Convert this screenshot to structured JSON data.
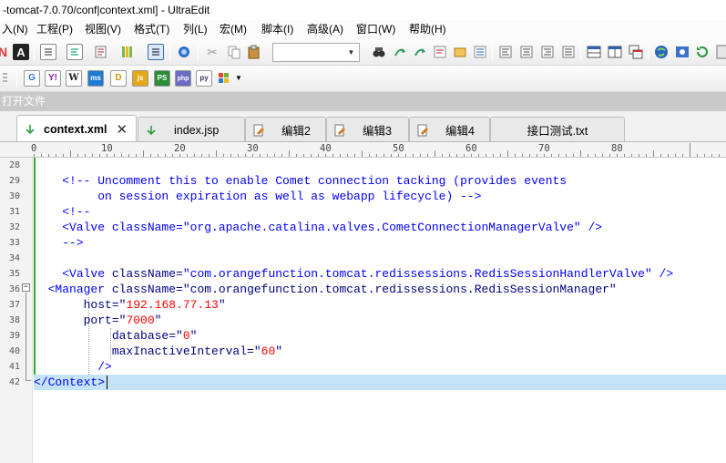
{
  "window": {
    "title": "-tomcat-7.0.70/conf|context.xml] - UltraEdit"
  },
  "menu": [
    {
      "label": "入(N)"
    },
    {
      "label": "工程(P)"
    },
    {
      "label": "视图(V)"
    },
    {
      "label": "格式(T)"
    },
    {
      "label": "列(L)"
    },
    {
      "label": "宏(M)"
    },
    {
      "label": "脚本(I)"
    },
    {
      "label": "高级(A)"
    },
    {
      "label": "窗口(W)"
    },
    {
      "label": "帮助(H)"
    }
  ],
  "toolbar": {
    "combo_value": ""
  },
  "openfile_label": "打开文件",
  "tabs": [
    {
      "label": "context.xml",
      "icon": "down-arrow-icon",
      "active": true
    },
    {
      "label": "index.jsp",
      "icon": "down-arrow-icon",
      "active": false
    },
    {
      "label": "编辑2",
      "icon": "edit-page-icon",
      "active": false
    },
    {
      "label": "编辑3",
      "icon": "edit-page-icon",
      "active": false
    },
    {
      "label": "编辑4",
      "icon": "edit-page-icon",
      "active": false
    },
    {
      "label": "接口测试.txt",
      "icon": "",
      "active": false
    }
  ],
  "ruler": {
    "labels": [
      "0",
      "10",
      "20",
      "30",
      "40",
      "50",
      "60",
      "70",
      "80"
    ]
  },
  "editor": {
    "current_line": 42,
    "line_numbers": [
      "28",
      "29",
      "30",
      "31",
      "32",
      "33",
      "34",
      "35",
      "36",
      "37",
      "38",
      "39",
      "40",
      "41",
      "42"
    ],
    "lines": [
      [],
      [
        {
          "t": "    <!-- Uncomment this to enable Comet connection tacking (provides events",
          "c": "cmt"
        }
      ],
      [
        {
          "t": "         on session expiration as well as webapp lifecycle) -->",
          "c": "cmt"
        }
      ],
      [
        {
          "t": "    <!--",
          "c": "cmt"
        }
      ],
      [
        {
          "t": "    <Valve className=\"org.apache.catalina.valves.CometConnectionManagerValve\" />",
          "c": "cmt"
        }
      ],
      [
        {
          "t": "    -->",
          "c": "cmt"
        }
      ],
      [],
      [
        {
          "t": "    ",
          "c": "attr"
        },
        {
          "t": "<Valve",
          "c": "tag"
        },
        {
          "t": " className",
          "c": "attr"
        },
        {
          "t": "=",
          "c": "eq"
        },
        {
          "t": "\"com.orangefunction.tomcat.redissessions.RedisSessionHandlerValve\"",
          "c": "tag"
        },
        {
          "t": " />",
          "c": "tag"
        }
      ],
      [
        {
          "t": "  ",
          "c": "attr"
        },
        {
          "t": "<Manager",
          "c": "tag"
        },
        {
          "t": " className",
          "c": "attr"
        },
        {
          "t": "=",
          "c": "eq"
        },
        {
          "t": "\"com.orangefunction.tomcat.redissessions.RedisSessionManager\"",
          "c": "attr"
        }
      ],
      [
        {
          "t": "       host",
          "c": "attr"
        },
        {
          "t": "=",
          "c": "eq"
        },
        {
          "t": "\"",
          "c": "attr"
        },
        {
          "t": "192.168.77.13",
          "c": "val"
        },
        {
          "t": "\"",
          "c": "attr"
        }
      ],
      [
        {
          "t": "       port",
          "c": "attr"
        },
        {
          "t": "=",
          "c": "eq"
        },
        {
          "t": "\"",
          "c": "attr"
        },
        {
          "t": "7000",
          "c": "val"
        },
        {
          "t": "\"",
          "c": "attr"
        }
      ],
      [
        {
          "t": "           database",
          "c": "attr"
        },
        {
          "t": "=",
          "c": "eq"
        },
        {
          "t": "\"",
          "c": "attr"
        },
        {
          "t": "0",
          "c": "val"
        },
        {
          "t": "\"",
          "c": "attr"
        }
      ],
      [
        {
          "t": "           maxInactiveInterval",
          "c": "attr"
        },
        {
          "t": "=",
          "c": "eq"
        },
        {
          "t": "\"",
          "c": "attr"
        },
        {
          "t": "60",
          "c": "val"
        },
        {
          "t": "\"",
          "c": "attr"
        }
      ],
      [
        {
          "t": "         />",
          "c": "tag"
        }
      ],
      [
        {
          "t": "</Context>",
          "c": "tag"
        }
      ]
    ]
  },
  "colors": {
    "tag": "#0000ff",
    "attribute": "#000080",
    "value": "#ff0000",
    "current_line_bg": "#c5e3f7",
    "modified_bar": "#2ea82e"
  }
}
